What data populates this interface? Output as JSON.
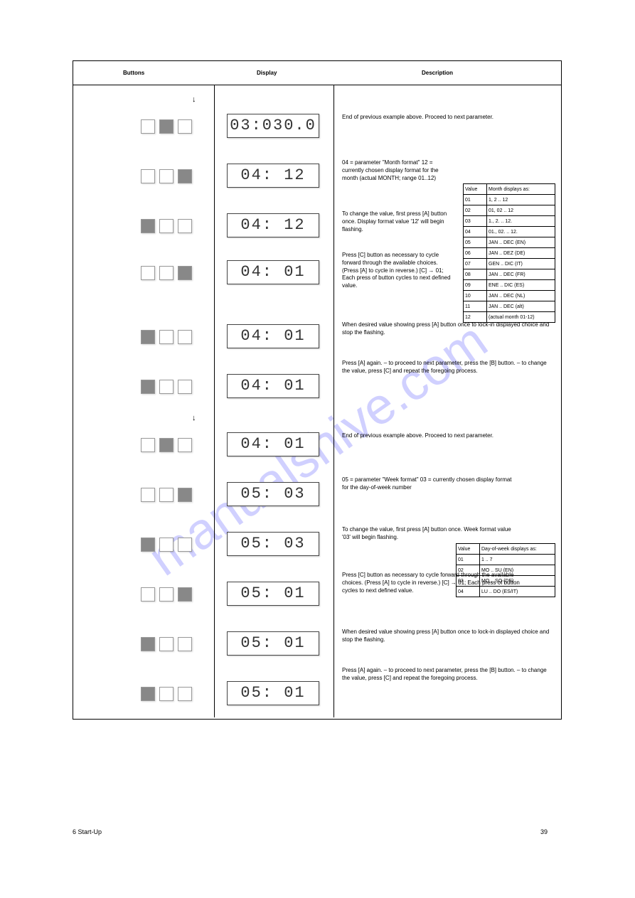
{
  "watermark": "manualshive.com",
  "headers": {
    "c1": "Buttons",
    "c2": "Display",
    "c3": "Description"
  },
  "arrows": {
    "a1": "↓",
    "a2": "↓"
  },
  "block1": {
    "r1": {
      "disp": "03:030.0",
      "d": "End of previous example above. Proceed to next parameter."
    },
    "r2": {
      "disp": "04:   12",
      "d": "04 = parameter \"Month format\" 12 = currently chosen display format for the month (actual MONTH; range 01..12)"
    },
    "r3": {
      "disp": "04:   12",
      "d": "To change the value, first press [A] button once. Display format value '12' will begin flashing."
    },
    "r4": {
      "disp": "04:   01",
      "d": "Press [C] button as necessary to cycle forward through the available choices. (Press [A] to cycle in reverse.) [C] → 01; Each press of button cycles to next defined value."
    },
    "r5": {
      "disp": "04:   01",
      "d": "When desired value showing press [A] button once to lock-in displayed choice and stop the flashing."
    },
    "r6": {
      "disp": "04:   01",
      "d": "Press [A] again. – to proceed to next parameter, press the [B] button. – to change the value, press [C] and repeat the foregoing process."
    }
  },
  "block2": {
    "r1": {
      "disp": "04:   01",
      "d": "End of previous example above. Proceed to next parameter."
    },
    "r2": {
      "disp": "05:   03",
      "d": "05 = parameter \"Week format\" 03 = currently chosen display format for the day-of-week number"
    },
    "r3": {
      "disp": "05:   03",
      "d": "To change the value, first press [A] button once. Week format value '03' will begin flashing."
    },
    "r4": {
      "disp": "05:   01",
      "d": "Press [C] button as necessary to cycle forward through the available choices. (Press [A] to cycle in reverse.) [C] → 01; Each press of button cycles to next defined value."
    },
    "r5": {
      "disp": "05:   01",
      "d": "When desired value showing press [A] button once to lock-in displayed choice and stop the flashing."
    },
    "r6": {
      "disp": "05:   01",
      "d": "Press [A] again. – to proceed to next parameter, press the [B] button. – to change the value, press [C] and repeat the foregoing process."
    }
  },
  "tbl1": {
    "h1": "Value",
    "h2": "Month displays as:",
    "rows": [
      [
        "01",
        "1, 2 .. 12"
      ],
      [
        "02",
        "01, 02 .. 12"
      ],
      [
        "03",
        "1., 2. .. 12."
      ],
      [
        "04",
        "01., 02. .. 12."
      ],
      [
        "05",
        "JAN .. DEC (EN)"
      ],
      [
        "06",
        "JAN .. DEZ (DE)"
      ],
      [
        "07",
        "GEN .. DIC (IT)"
      ],
      [
        "08",
        "JAN .. DEC (FR)"
      ],
      [
        "09",
        "ENE .. DIC (ES)"
      ],
      [
        "10",
        "JAN .. DEC (NL)"
      ],
      [
        "11",
        "JAN .. DEC (alt)"
      ],
      [
        "12",
        "(actual month 01-12)"
      ]
    ]
  },
  "tbl2": {
    "h1": "Value",
    "h2": "Day-of-week displays as:",
    "rows": [
      [
        "01",
        "1 .. 7"
      ],
      [
        "02",
        "MO .. SU (EN)"
      ],
      [
        "03",
        "MO .. SO (DE)"
      ],
      [
        "04",
        "LU .. DO (ES/IT)"
      ]
    ]
  },
  "foot": {
    "sec": "6  Start-Up",
    "page": "39"
  }
}
